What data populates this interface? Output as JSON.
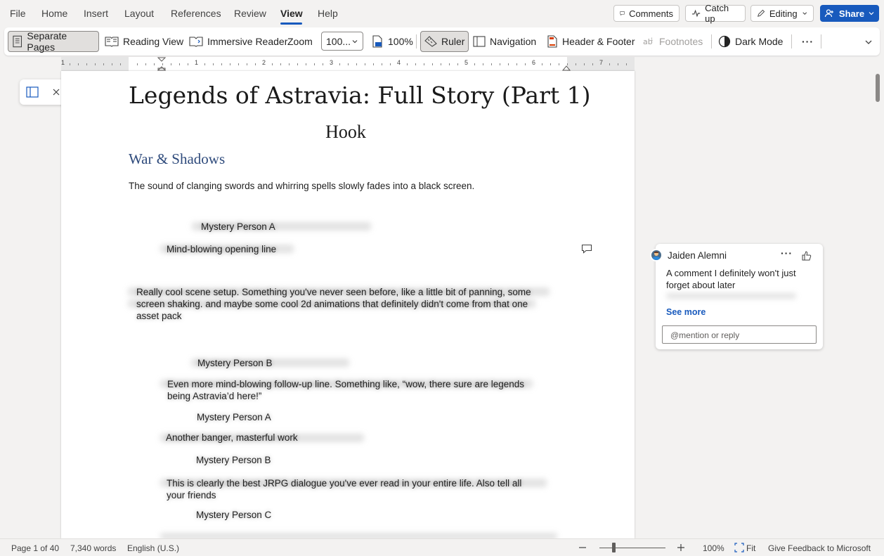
{
  "menu": {
    "items": [
      "File",
      "Home",
      "Insert",
      "Layout",
      "References",
      "Review",
      "View",
      "Help"
    ],
    "active": "View"
  },
  "top_actions": {
    "comments": "Comments",
    "catch_up": "Catch up",
    "editing": "Editing",
    "share": "Share"
  },
  "ribbon": {
    "separate_pages": "Separate Pages",
    "reading_view": "Reading View",
    "immersive_reader": "Immersive Reader",
    "zoom_label": "Zoom",
    "zoom_value": "100...",
    "zoom_100": "100%",
    "ruler": "Ruler",
    "navigation": "Navigation",
    "header_footer": "Header & Footer",
    "footnotes": "Footnotes",
    "dark_mode": "Dark Mode",
    "more": "···"
  },
  "ruler": {
    "numbers": [
      "1",
      "1",
      "2",
      "3",
      "4",
      "5",
      "6",
      "7"
    ]
  },
  "document": {
    "title": "Legends of Astravia: Full Story (Part 1)",
    "subtitle": "Hook",
    "heading": "War & Shadows",
    "intro": "The sound of clanging swords and whirring spells slowly fades into a black screen.",
    "lines": [
      "Mystery Person A",
      "Mind-blowing opening line",
      "Really cool scene setup. Something you've never seen before, like a little bit of panning, some screen shaking. and maybe some cool 2d animations that definitely didn't come from that one asset pack",
      "Mystery Person B",
      "Even more mind-blowing follow-up line. Something like, “wow, there sure are legends being Astravia’d here!”",
      "Mystery Person A",
      "Another banger, masterful work",
      "Mystery Person B",
      "This is clearly the best JRPG dialogue you've ever read in your entire life. Also tell all your friends",
      "Mystery Person C"
    ]
  },
  "comment": {
    "author": "Jaiden Alemni",
    "text": "A comment I definitely won't just forget about later",
    "see_more": "See more",
    "reply_placeholder": "@mention or reply"
  },
  "status": {
    "page": "Page 1 of 40",
    "words": "7,340 words",
    "language": "English (U.S.)",
    "zoom": "100%",
    "fit": "Fit",
    "feedback": "Give Feedback to Microsoft",
    "zoom_level": 0.2
  },
  "colors": {
    "accent": "#185abd",
    "heading": "#2f4b7c"
  }
}
